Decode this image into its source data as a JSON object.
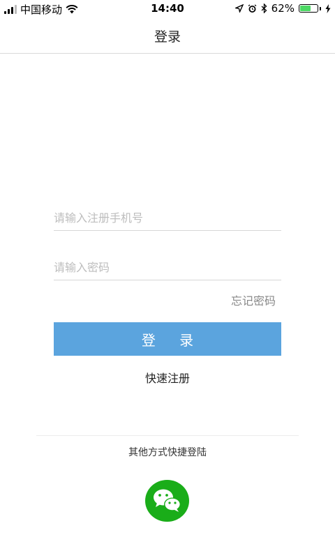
{
  "status_bar": {
    "carrier": "中国移动",
    "time": "14:40",
    "battery_percent": "62%",
    "battery_level": 0.62,
    "icons": [
      "signal-icon",
      "wifi-icon",
      "location-icon",
      "alarm-icon",
      "bluetooth-icon",
      "battery-icon",
      "charging-icon"
    ]
  },
  "nav": {
    "title": "登录"
  },
  "form": {
    "phone_placeholder": "请输入注册手机号",
    "phone_value": "",
    "password_placeholder": "请输入密码",
    "password_value": "",
    "forgot_label": "忘记密码",
    "login_label": "登 录",
    "register_label": "快速注册"
  },
  "other_login": {
    "label": "其他方式快捷登陆",
    "icon": "wechat-icon"
  },
  "colors": {
    "primary": "#5ba4de",
    "wechat": "#1aad19",
    "battery": "#4cd964"
  }
}
